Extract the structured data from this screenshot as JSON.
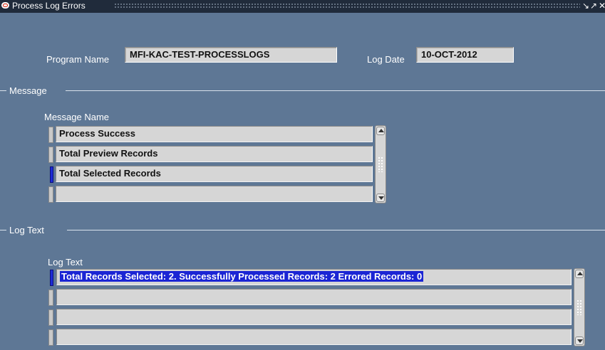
{
  "window": {
    "title": "Process Log Errors",
    "controls": [
      "↘",
      "↗",
      "✕"
    ]
  },
  "header": {
    "program_name_label": "Program Name",
    "program_name_value": "MFI-KAC-TEST-PROCESSLOGS",
    "log_date_label": "Log Date",
    "log_date_value": "10-OCT-2012"
  },
  "message_section": {
    "title": "Message",
    "column_label": "Message Name",
    "rows": [
      "Process Success",
      "Total Preview Records",
      "Total Selected Records",
      ""
    ],
    "active_row": 2
  },
  "logtext_section": {
    "title": "Log Text",
    "column_label": "Log Text",
    "rows": [
      "Total Records Selected: 2. Successfully Processed Records: 2 Errored Records:  0",
      "",
      "",
      ""
    ],
    "active_row": 0
  },
  "colors": {
    "background": "#5e7795",
    "titlebar": "#202b3b",
    "field": "#d6d6d6",
    "selection": "#1b25d4"
  }
}
